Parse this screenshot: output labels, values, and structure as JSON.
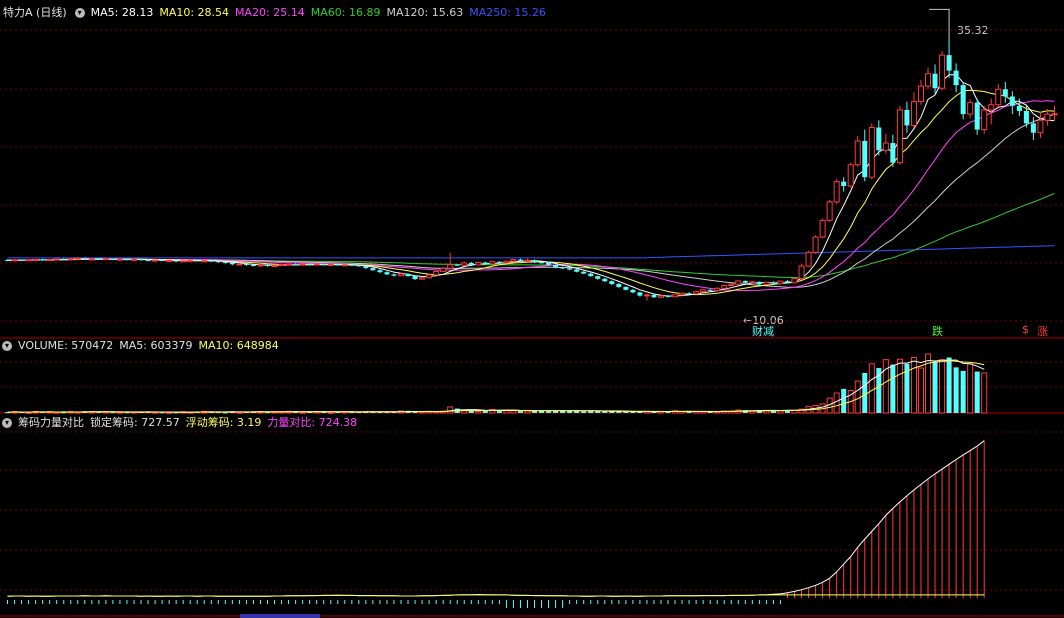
{
  "colors": {
    "up": "#ff3b3b",
    "down": "#54ffff",
    "grid": "#7a0000",
    "ma5": "#ffffff",
    "ma10": "#ffff55",
    "ma20": "#ff44ff",
    "ma60": "#33cc33",
    "ma120": "#cfcfcf",
    "ma250": "#3355ff",
    "title": "#e0e0e0"
  },
  "price_panel": {
    "title": "特力A (日线)",
    "ma": [
      {
        "label": "MA5: 28.13",
        "color": "#ffffff"
      },
      {
        "label": "MA10: 28.54",
        "color": "#ffff55"
      },
      {
        "label": "MA20: 25.14",
        "color": "#ff44ff"
      },
      {
        "label": "MA60: 16.89",
        "color": "#33cc33"
      },
      {
        "label": "MA120: 15.63",
        "color": "#cfcfcf"
      },
      {
        "label": "MA250: 15.26",
        "color": "#3355ff"
      }
    ],
    "high_label": "35.32",
    "low_label": "10.06",
    "markers": [
      {
        "text": "财减",
        "color": "#54ffff"
      },
      {
        "text": "跌",
        "color": "#33ff33"
      },
      {
        "text": "$",
        "color": "#ff3b3b"
      },
      {
        "text": "涨",
        "color": "#ff3b3b"
      }
    ]
  },
  "volume_panel": {
    "items": [
      {
        "label": "VOLUME: 570472",
        "color": "#e0e0e0"
      },
      {
        "label": "MA5: 603379",
        "color": "#e0e0e0"
      },
      {
        "label": "MA10: 648984",
        "color": "#ffff55"
      }
    ]
  },
  "chip_panel": {
    "items": [
      {
        "label": "筹码力量对比",
        "color": "#e0e0e0"
      },
      {
        "label": "锁定筹码: 727.57",
        "color": "#e0e0e0"
      },
      {
        "label": "浮动筹码: 3.19",
        "color": "#ffff55"
      },
      {
        "label": "力量对比: 724.38",
        "color": "#ff44ff"
      }
    ]
  },
  "chart_data": {
    "type": "candlestick",
    "n": 140,
    "price_range": [
      8,
      37
    ],
    "candles": [
      [
        14.0,
        13.96,
        13.88,
        14.07
      ],
      [
        13.96,
        14.01,
        13.89,
        14.11
      ],
      [
        14.01,
        13.98,
        13.9,
        14.06
      ],
      [
        13.98,
        14.02,
        13.91,
        14.08
      ],
      [
        14.02,
        14.04,
        13.97,
        14.1
      ],
      [
        14.04,
        13.97,
        13.91,
        14.13
      ],
      [
        13.97,
        14.03,
        13.92,
        14.08
      ],
      [
        14.03,
        14.1,
        13.95,
        14.16
      ],
      [
        14.1,
        14.08,
        14.0,
        14.18
      ],
      [
        14.08,
        14.12,
        14.01,
        14.18
      ],
      [
        14.12,
        14.17,
        14.03,
        14.27
      ],
      [
        14.17,
        14.06,
        14.02,
        14.24
      ],
      [
        14.06,
        14.09,
        14.04,
        14.15
      ],
      [
        14.09,
        14.04,
        14.0,
        14.18
      ],
      [
        14.04,
        14.12,
        14.0,
        14.18
      ],
      [
        14.12,
        14.06,
        14.0,
        14.13
      ],
      [
        14.06,
        14.07,
        13.98,
        14.14
      ],
      [
        14.07,
        14.0,
        13.95,
        14.11
      ],
      [
        14.0,
        14.06,
        13.91,
        14.13
      ],
      [
        14.06,
        14.01,
        13.97,
        14.12
      ],
      [
        14.01,
        13.96,
        13.85,
        14.04
      ],
      [
        13.96,
        13.99,
        13.86,
        14.02
      ],
      [
        13.99,
        13.92,
        13.87,
        14.04
      ],
      [
        13.92,
        13.95,
        13.86,
        14.02
      ],
      [
        13.95,
        13.89,
        13.79,
        13.99
      ],
      [
        13.89,
        13.92,
        13.8,
        13.96
      ],
      [
        13.92,
        13.95,
        13.84,
        14.04
      ],
      [
        13.95,
        13.91,
        13.86,
        14.01
      ],
      [
        13.91,
        13.93,
        13.85,
        14.02
      ],
      [
        13.93,
        13.88,
        13.8,
        13.99
      ],
      [
        13.88,
        13.79,
        13.69,
        13.93
      ],
      [
        13.79,
        13.73,
        13.65,
        13.86
      ],
      [
        13.73,
        13.58,
        13.49,
        13.78
      ],
      [
        13.58,
        13.61,
        13.52,
        13.7
      ],
      [
        13.61,
        13.51,
        13.42,
        13.71
      ],
      [
        13.51,
        13.42,
        13.37,
        13.54
      ],
      [
        13.42,
        13.53,
        13.33,
        13.59
      ],
      [
        13.53,
        13.42,
        13.35,
        13.6
      ],
      [
        13.42,
        13.46,
        13.41,
        13.53
      ],
      [
        13.46,
        13.56,
        13.41,
        13.65
      ],
      [
        13.56,
        13.59,
        13.47,
        13.64
      ],
      [
        13.59,
        13.52,
        13.47,
        13.66
      ],
      [
        13.52,
        13.6,
        13.42,
        13.71
      ],
      [
        13.6,
        13.55,
        13.47,
        13.66
      ],
      [
        13.55,
        13.6,
        13.51,
        13.68
      ],
      [
        13.6,
        13.52,
        13.45,
        13.64
      ],
      [
        13.52,
        13.56,
        13.44,
        13.63
      ],
      [
        13.56,
        13.49,
        13.46,
        13.62
      ],
      [
        13.49,
        13.53,
        13.43,
        13.58
      ],
      [
        13.53,
        13.48,
        13.4,
        13.55
      ],
      [
        13.48,
        13.39,
        13.33,
        13.51
      ],
      [
        13.39,
        13.21,
        13.14,
        13.43
      ],
      [
        13.21,
        13.0,
        12.95,
        13.29
      ],
      [
        13.0,
        12.82,
        12.73,
        13.12
      ],
      [
        12.82,
        12.61,
        12.52,
        12.91
      ],
      [
        12.61,
        12.48,
        12.39,
        12.69
      ],
      [
        12.48,
        12.65,
        12.42,
        12.78
      ],
      [
        12.65,
        12.44,
        12.37,
        12.7
      ],
      [
        12.44,
        12.15,
        12.06,
        12.49
      ],
      [
        12.15,
        12.28,
        12.06,
        12.36
      ],
      [
        12.28,
        12.55,
        12.23,
        12.63
      ],
      [
        12.55,
        12.89,
        12.48,
        12.98
      ],
      [
        12.89,
        13.19,
        12.84,
        13.3
      ],
      [
        13.19,
        13.54,
        13.1,
        14.7
      ],
      [
        13.54,
        13.49,
        13.44,
        13.62
      ],
      [
        13.49,
        13.71,
        13.43,
        13.83
      ],
      [
        13.71,
        13.52,
        13.44,
        13.8
      ],
      [
        13.52,
        13.75,
        13.47,
        13.84
      ],
      [
        13.75,
        13.61,
        13.55,
        13.84
      ],
      [
        13.61,
        13.82,
        13.56,
        13.92
      ],
      [
        13.82,
        13.73,
        13.68,
        13.89
      ],
      [
        13.73,
        13.88,
        13.67,
        13.94
      ],
      [
        13.88,
        14.03,
        13.79,
        14.09
      ],
      [
        14.03,
        13.91,
        13.81,
        14.12
      ],
      [
        13.91,
        13.97,
        13.88,
        14.13
      ],
      [
        13.97,
        13.77,
        13.69,
        14.05
      ],
      [
        13.77,
        13.74,
        13.65,
        13.85
      ],
      [
        13.74,
        13.52,
        13.43,
        13.8
      ],
      [
        13.52,
        13.27,
        13.19,
        13.57
      ],
      [
        13.27,
        13.19,
        13.13,
        13.36
      ],
      [
        13.19,
        13.07,
        12.99,
        13.24
      ],
      [
        13.07,
        12.86,
        12.8,
        13.14
      ],
      [
        12.86,
        12.68,
        12.63,
        12.92
      ],
      [
        12.68,
        12.43,
        12.38,
        12.77
      ],
      [
        12.43,
        12.18,
        12.09,
        12.47
      ],
      [
        12.18,
        11.94,
        11.86,
        12.26
      ],
      [
        11.94,
        11.67,
        11.57,
        12.02
      ],
      [
        11.67,
        11.39,
        11.3,
        11.75
      ],
      [
        11.39,
        11.11,
        11.05,
        11.44
      ],
      [
        11.11,
        10.86,
        10.79,
        11.17
      ],
      [
        10.86,
        10.55,
        10.45,
        10.92
      ],
      [
        10.55,
        10.62,
        10.06,
        10.7
      ],
      [
        10.62,
        10.39,
        10.32,
        10.66
      ],
      [
        10.39,
        10.53,
        10.33,
        10.6
      ],
      [
        10.53,
        10.44,
        10.35,
        10.61
      ],
      [
        10.44,
        10.63,
        10.36,
        10.68
      ],
      [
        10.63,
        10.78,
        10.54,
        10.83
      ],
      [
        10.78,
        10.73,
        10.66,
        10.87
      ],
      [
        10.73,
        10.93,
        10.66,
        11.03
      ],
      [
        10.93,
        11.11,
        10.87,
        11.19
      ],
      [
        11.11,
        11.04,
        10.97,
        11.17
      ],
      [
        11.04,
        11.26,
        10.99,
        11.36
      ],
      [
        11.26,
        11.53,
        11.17,
        11.61
      ],
      [
        11.53,
        11.65,
        11.45,
        11.73
      ],
      [
        11.65,
        11.97,
        11.61,
        12.03
      ],
      [
        11.97,
        11.79,
        11.71,
        12.02
      ],
      [
        11.79,
        11.88,
        11.73,
        11.97
      ],
      [
        11.88,
        11.64,
        11.59,
        11.93
      ],
      [
        11.64,
        11.84,
        11.6,
        11.9
      ],
      [
        11.84,
        11.7,
        11.62,
        11.94
      ],
      [
        11.7,
        11.95,
        11.61,
        12.02
      ],
      [
        11.95,
        11.79,
        11.72,
        12.05
      ],
      [
        11.79,
        12.2,
        11.75,
        12.25
      ],
      [
        12.2,
        13.4,
        12.1,
        13.6
      ],
      [
        13.4,
        14.73,
        13.35,
        14.9
      ],
      [
        14.73,
        16.21,
        14.6,
        16.4
      ],
      [
        16.21,
        17.83,
        16.1,
        18.0
      ],
      [
        17.83,
        19.61,
        17.7,
        19.8
      ],
      [
        19.61,
        21.57,
        19.4,
        21.8
      ],
      [
        21.57,
        21.15,
        20.6,
        22.0
      ],
      [
        21.15,
        23.2,
        21.0,
        23.4
      ],
      [
        23.2,
        25.5,
        23.0,
        26.0
      ],
      [
        25.5,
        22.0,
        21.6,
        26.6
      ],
      [
        22.0,
        26.8,
        21.8,
        27.2
      ],
      [
        26.8,
        24.6,
        24.1,
        27.5
      ],
      [
        24.6,
        25.3,
        24.3,
        26.2
      ],
      [
        25.3,
        23.4,
        23.0,
        26.1
      ],
      [
        23.4,
        28.5,
        23.2,
        28.9
      ],
      [
        28.5,
        27.0,
        26.3,
        29.3
      ],
      [
        27.0,
        29.3,
        26.8,
        30.2
      ],
      [
        29.3,
        30.8,
        29.0,
        31.4
      ],
      [
        30.8,
        32.0,
        30.5,
        32.6
      ],
      [
        32.0,
        30.6,
        30.1,
        32.9
      ],
      [
        30.6,
        33.8,
        30.4,
        34.2
      ],
      [
        33.8,
        32.3,
        31.6,
        35.32
      ],
      [
        32.3,
        30.9,
        30.2,
        33.0
      ],
      [
        30.9,
        28.1,
        27.6,
        31.2
      ],
      [
        28.1,
        29.2,
        27.7,
        29.5
      ],
      [
        29.2,
        26.6,
        26.1,
        29.6
      ],
      [
        26.6,
        28.5,
        26.2,
        28.9
      ],
      [
        28.5,
        29.0,
        27.1,
        29.6
      ],
      [
        29.0,
        30.5,
        28.8,
        31.0
      ],
      [
        30.5,
        29.8,
        29.2,
        31.2
      ],
      [
        29.8,
        28.9,
        28.1,
        30.3
      ],
      [
        28.9,
        28.4,
        27.9,
        29.6
      ],
      [
        28.4,
        27.2,
        26.8,
        28.9
      ],
      [
        27.2,
        26.3,
        25.6,
        27.8
      ],
      [
        26.3,
        27.5,
        25.8,
        28.3
      ],
      [
        27.5,
        28.1,
        27.0,
        28.6
      ],
      [
        28.1,
        28.13,
        27.5,
        28.9
      ]
    ],
    "volume": [
      12,
      18,
      14,
      9,
      22,
      14,
      18,
      11,
      10,
      20,
      13,
      24,
      20,
      18,
      17,
      12,
      11,
      11,
      13,
      14,
      23,
      12,
      10,
      9,
      10,
      18,
      11,
      18,
      23,
      14,
      15,
      9,
      23,
      11,
      15,
      23,
      19,
      12,
      16,
      19,
      24,
      20,
      11,
      14,
      22,
      25,
      10,
      15,
      17,
      17,
      14,
      21,
      20,
      15,
      19,
      15,
      29,
      31,
      16,
      15,
      20,
      19,
      27,
      86,
      63,
      34,
      33,
      22,
      38,
      51,
      35,
      32,
      32,
      28,
      38,
      37,
      30,
      26,
      34,
      39,
      38,
      31,
      23,
      31,
      25,
      28,
      24,
      21,
      18,
      18,
      17,
      25,
      18,
      23,
      21,
      31,
      19,
      24,
      19,
      18,
      23,
      16,
      28,
      29,
      42,
      39,
      27,
      38,
      36,
      43,
      34,
      44,
      36,
      55,
      95,
      107,
      130,
      212,
      285,
      344,
      320,
      455,
      570,
      700,
      640,
      760,
      690,
      765,
      700,
      790,
      640,
      840,
      730,
      760,
      790,
      650,
      600,
      700,
      590,
      570
    ],
    "chip": [
      8,
      9,
      9,
      8,
      9,
      8,
      8,
      9,
      9,
      9,
      9,
      10,
      9,
      9,
      10,
      9,
      9,
      9,
      9,
      8,
      9,
      8,
      8,
      9,
      8,
      9,
      9,
      8,
      9,
      9,
      8,
      8,
      8,
      8,
      8,
      8,
      8,
      8,
      9,
      9,
      10,
      10,
      10,
      11,
      11,
      12,
      12,
      13,
      12,
      12,
      11,
      11,
      11,
      10,
      10,
      10,
      9,
      9,
      9,
      10,
      10,
      11,
      12,
      13,
      14,
      15,
      15,
      16,
      15,
      15,
      14,
      14,
      13,
      12,
      12,
      11,
      11,
      10,
      10,
      10,
      9,
      9,
      8,
      8,
      9,
      9,
      8,
      8,
      9,
      8,
      8,
      9,
      9,
      9,
      10,
      10,
      10,
      10,
      10,
      11,
      11,
      11,
      11,
      12,
      12,
      12,
      13,
      14,
      15,
      17,
      19,
      24,
      30,
      38,
      47,
      58,
      72,
      90,
      120,
      155,
      190,
      232,
      270,
      305,
      340,
      378,
      410,
      440,
      468,
      495,
      520,
      545,
      568,
      590,
      612,
      634,
      655,
      675,
      696,
      720
    ]
  }
}
